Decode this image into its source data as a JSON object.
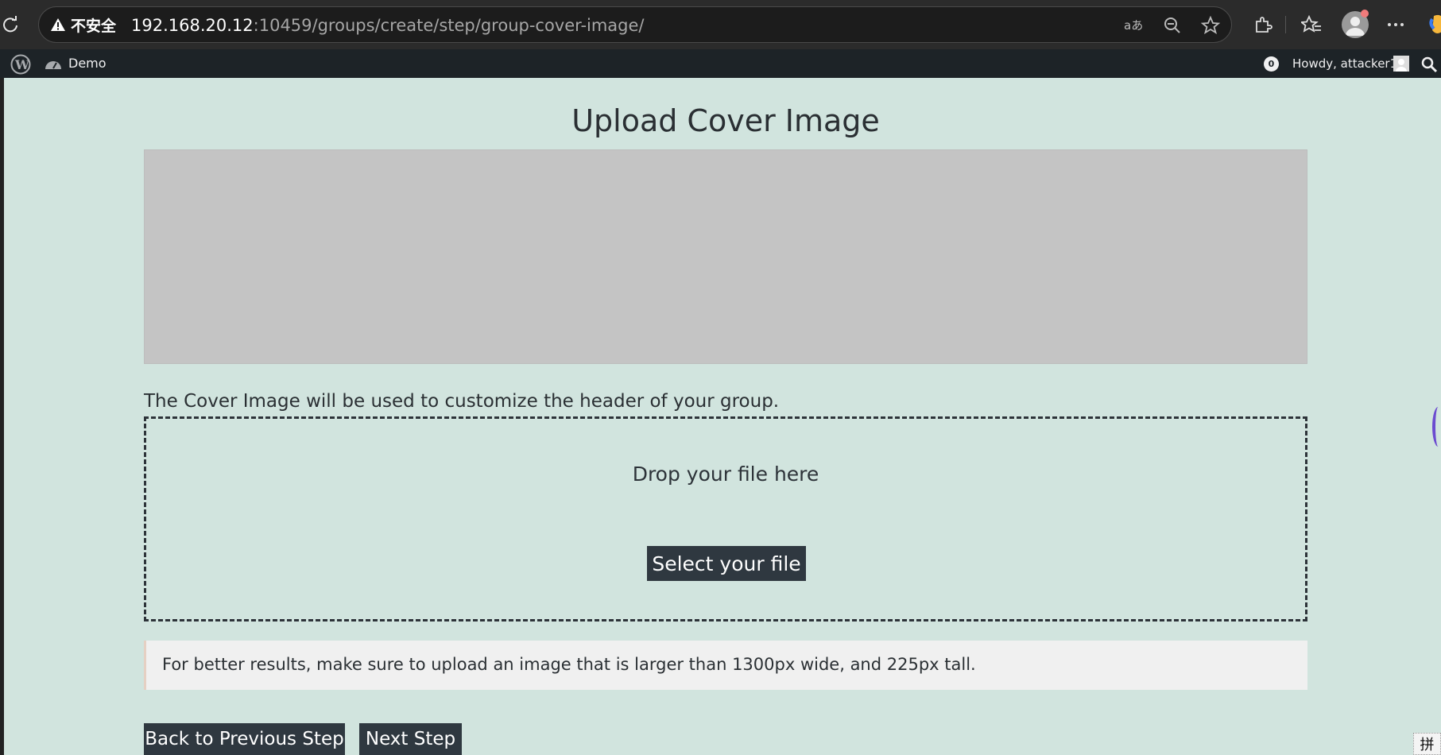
{
  "browser": {
    "security_label": "不安全",
    "url_host": "192.168.20.12",
    "url_rest": ":10459/groups/create/step/group-cover-image/",
    "icons": [
      "reload-icon",
      "warning-icon",
      "read-aloud-icon",
      "zoom-out-icon",
      "favorite-star-icon",
      "extensions-icon",
      "favorites-icon",
      "profile-avatar",
      "more-icon",
      "copilot-icon"
    ]
  },
  "adminbar": {
    "site_name": "Demo",
    "notifications": "0",
    "howdy": "Howdy, attacker1"
  },
  "main": {
    "title": "Upload Cover Image",
    "description": "The Cover Image will be used to customize the header of your group.",
    "drop_text": "Drop your file here",
    "select_button": "Select your file",
    "notice": "For better results, make sure to upload an image that is larger than 1300px wide, and 225px tall.",
    "back_button": "Back to Previous Step",
    "next_button": "Next Step"
  },
  "ime_indicator": "拼",
  "colors": {
    "page_background": "#d1e4de",
    "button_dark": "#2f3840",
    "admin_bar": "#1d2327",
    "preview_gray": "#c4c4c4"
  }
}
